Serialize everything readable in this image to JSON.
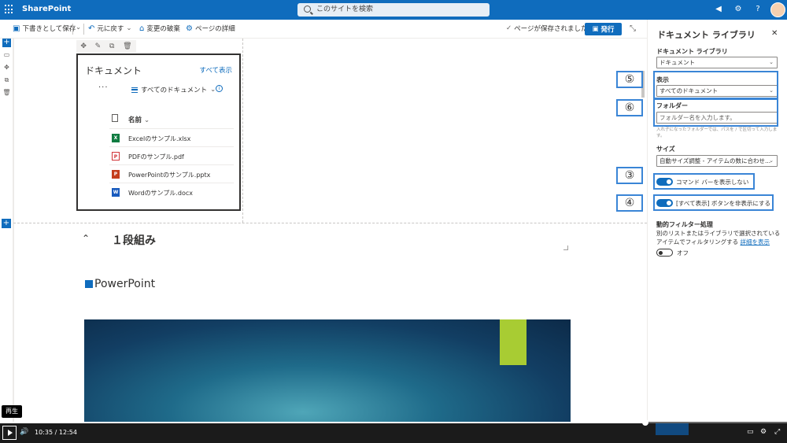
{
  "suite": {
    "app_name": "SharePoint",
    "search_placeholder": "このサイトを検索",
    "icons": [
      "waffle-icon",
      "megaphone-icon",
      "gear-icon",
      "help-icon",
      "avatar"
    ]
  },
  "commandbar": {
    "save_draft": "下書きとして保存",
    "undo": "元に戻す",
    "discard": "変更の破棄",
    "page_details": "ページの詳細",
    "saved_status": "ページが保存されました",
    "publish": "発行"
  },
  "webpart_toolbar": [
    "move-icon",
    "edit-icon",
    "duplicate-icon",
    "delete-icon"
  ],
  "doclib": {
    "title": "ドキュメント",
    "see_all": "すべて表示",
    "more": "···",
    "view": "すべてのドキュメント",
    "column_name": "名前",
    "files": [
      {
        "name": "Excelのサンプル.xlsx",
        "type": "excel",
        "color": "#107c41",
        "glyph": "X"
      },
      {
        "name": "PDFのサンプル.pdf",
        "type": "pdf",
        "color": "#d13438",
        "glyph": "P"
      },
      {
        "name": "PowerPointのサンプル.pptx",
        "type": "powerpoint",
        "color": "#c43e1c",
        "glyph": "P"
      },
      {
        "name": "Wordのサンプル.docx",
        "type": "word",
        "color": "#185abd",
        "glyph": "W"
      }
    ]
  },
  "section": {
    "title": "１段組み",
    "heading": "PowerPoint"
  },
  "panel": {
    "title": "ドキュメント ライブラリ",
    "library_label": "ドキュメント ライブラリ",
    "library_value": "ドキュメント",
    "view_label": "表示",
    "view_value": "すべてのドキュメント",
    "folder_label": "フォルダー",
    "folder_placeholder": "フォルダー名を入力します。",
    "folder_hint": "入れ子になったフォルダーでは、パスを / で区切って入力します。",
    "size_label": "サイズ",
    "size_value": "自動サイズ調整 - アイテムの数に合わせ...",
    "toggle_commandbar": "コマンド バーを表示しない",
    "toggle_seeall": "[すべて表示] ボタンを非表示にする",
    "dynamic_label": "動的フィルター処理",
    "dynamic_text1": "別のリストまたはライブラリで選択されている",
    "dynamic_text2": "アイテムでフィルタリングする",
    "dynamic_link": "詳細を表示",
    "dynamic_state": "オフ"
  },
  "annotations": [
    "⑤",
    "⑥",
    "③",
    "④"
  ],
  "video": {
    "tooltip": "再生",
    "current": "10:35",
    "separator": "/",
    "total": "12:54",
    "progress": 0.82
  },
  "colors": {
    "brand": "#0f6cbd",
    "annotation": "#3a85d6",
    "accent_green": "#a8cc33"
  }
}
